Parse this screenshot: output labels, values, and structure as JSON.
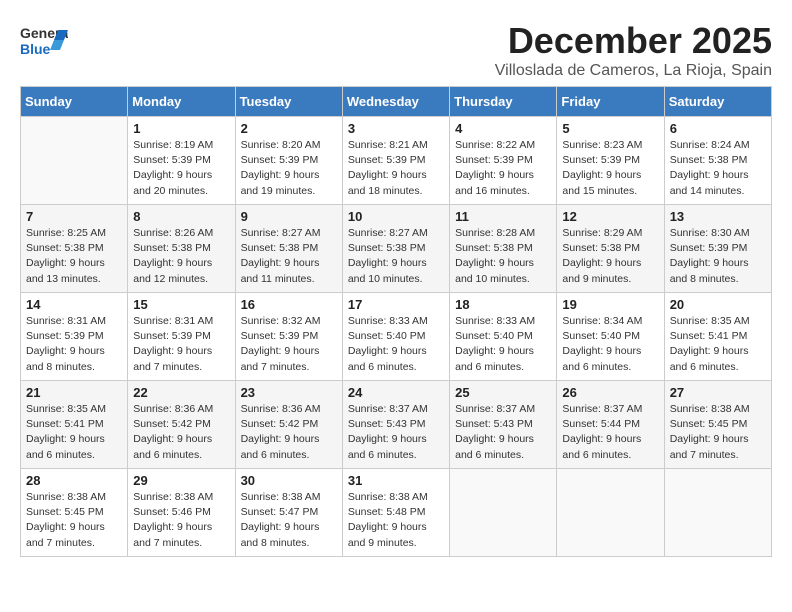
{
  "header": {
    "logo_line1": "General",
    "logo_line2": "Blue",
    "title": "December 2025",
    "subtitle": "Villoslada de Cameros, La Rioja, Spain"
  },
  "columns": [
    "Sunday",
    "Monday",
    "Tuesday",
    "Wednesday",
    "Thursday",
    "Friday",
    "Saturday"
  ],
  "weeks": [
    [
      {
        "day": "",
        "info": ""
      },
      {
        "day": "1",
        "info": "Sunrise: 8:19 AM\nSunset: 5:39 PM\nDaylight: 9 hours\nand 20 minutes."
      },
      {
        "day": "2",
        "info": "Sunrise: 8:20 AM\nSunset: 5:39 PM\nDaylight: 9 hours\nand 19 minutes."
      },
      {
        "day": "3",
        "info": "Sunrise: 8:21 AM\nSunset: 5:39 PM\nDaylight: 9 hours\nand 18 minutes."
      },
      {
        "day": "4",
        "info": "Sunrise: 8:22 AM\nSunset: 5:39 PM\nDaylight: 9 hours\nand 16 minutes."
      },
      {
        "day": "5",
        "info": "Sunrise: 8:23 AM\nSunset: 5:39 PM\nDaylight: 9 hours\nand 15 minutes."
      },
      {
        "day": "6",
        "info": "Sunrise: 8:24 AM\nSunset: 5:38 PM\nDaylight: 9 hours\nand 14 minutes."
      }
    ],
    [
      {
        "day": "7",
        "info": "Sunrise: 8:25 AM\nSunset: 5:38 PM\nDaylight: 9 hours\nand 13 minutes."
      },
      {
        "day": "8",
        "info": "Sunrise: 8:26 AM\nSunset: 5:38 PM\nDaylight: 9 hours\nand 12 minutes."
      },
      {
        "day": "9",
        "info": "Sunrise: 8:27 AM\nSunset: 5:38 PM\nDaylight: 9 hours\nand 11 minutes."
      },
      {
        "day": "10",
        "info": "Sunrise: 8:27 AM\nSunset: 5:38 PM\nDaylight: 9 hours\nand 10 minutes."
      },
      {
        "day": "11",
        "info": "Sunrise: 8:28 AM\nSunset: 5:38 PM\nDaylight: 9 hours\nand 10 minutes."
      },
      {
        "day": "12",
        "info": "Sunrise: 8:29 AM\nSunset: 5:38 PM\nDaylight: 9 hours\nand 9 minutes."
      },
      {
        "day": "13",
        "info": "Sunrise: 8:30 AM\nSunset: 5:39 PM\nDaylight: 9 hours\nand 8 minutes."
      }
    ],
    [
      {
        "day": "14",
        "info": "Sunrise: 8:31 AM\nSunset: 5:39 PM\nDaylight: 9 hours\nand 8 minutes."
      },
      {
        "day": "15",
        "info": "Sunrise: 8:31 AM\nSunset: 5:39 PM\nDaylight: 9 hours\nand 7 minutes."
      },
      {
        "day": "16",
        "info": "Sunrise: 8:32 AM\nSunset: 5:39 PM\nDaylight: 9 hours\nand 7 minutes."
      },
      {
        "day": "17",
        "info": "Sunrise: 8:33 AM\nSunset: 5:40 PM\nDaylight: 9 hours\nand 6 minutes."
      },
      {
        "day": "18",
        "info": "Sunrise: 8:33 AM\nSunset: 5:40 PM\nDaylight: 9 hours\nand 6 minutes."
      },
      {
        "day": "19",
        "info": "Sunrise: 8:34 AM\nSunset: 5:40 PM\nDaylight: 9 hours\nand 6 minutes."
      },
      {
        "day": "20",
        "info": "Sunrise: 8:35 AM\nSunset: 5:41 PM\nDaylight: 9 hours\nand 6 minutes."
      }
    ],
    [
      {
        "day": "21",
        "info": "Sunrise: 8:35 AM\nSunset: 5:41 PM\nDaylight: 9 hours\nand 6 minutes."
      },
      {
        "day": "22",
        "info": "Sunrise: 8:36 AM\nSunset: 5:42 PM\nDaylight: 9 hours\nand 6 minutes."
      },
      {
        "day": "23",
        "info": "Sunrise: 8:36 AM\nSunset: 5:42 PM\nDaylight: 9 hours\nand 6 minutes."
      },
      {
        "day": "24",
        "info": "Sunrise: 8:37 AM\nSunset: 5:43 PM\nDaylight: 9 hours\nand 6 minutes."
      },
      {
        "day": "25",
        "info": "Sunrise: 8:37 AM\nSunset: 5:43 PM\nDaylight: 9 hours\nand 6 minutes."
      },
      {
        "day": "26",
        "info": "Sunrise: 8:37 AM\nSunset: 5:44 PM\nDaylight: 9 hours\nand 6 minutes."
      },
      {
        "day": "27",
        "info": "Sunrise: 8:38 AM\nSunset: 5:45 PM\nDaylight: 9 hours\nand 7 minutes."
      }
    ],
    [
      {
        "day": "28",
        "info": "Sunrise: 8:38 AM\nSunset: 5:45 PM\nDaylight: 9 hours\nand 7 minutes."
      },
      {
        "day": "29",
        "info": "Sunrise: 8:38 AM\nSunset: 5:46 PM\nDaylight: 9 hours\nand 7 minutes."
      },
      {
        "day": "30",
        "info": "Sunrise: 8:38 AM\nSunset: 5:47 PM\nDaylight: 9 hours\nand 8 minutes."
      },
      {
        "day": "31",
        "info": "Sunrise: 8:38 AM\nSunset: 5:48 PM\nDaylight: 9 hours\nand 9 minutes."
      },
      {
        "day": "",
        "info": ""
      },
      {
        "day": "",
        "info": ""
      },
      {
        "day": "",
        "info": ""
      }
    ]
  ]
}
